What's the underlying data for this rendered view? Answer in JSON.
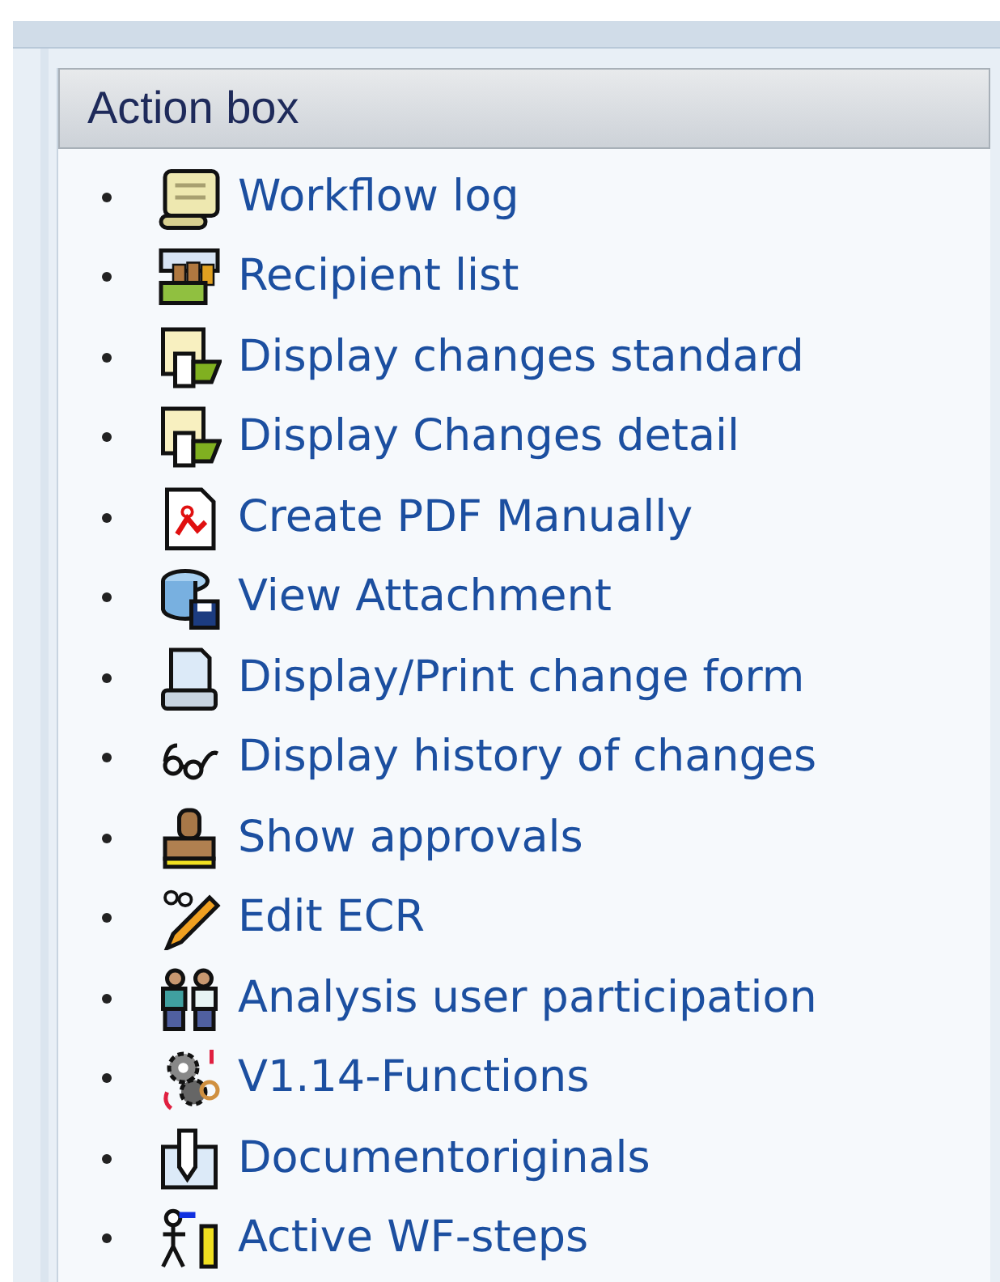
{
  "panel": {
    "title": "Action box",
    "items": [
      {
        "label": "Workflow log"
      },
      {
        "label": "Recipient list"
      },
      {
        "label": "Display changes standard"
      },
      {
        "label": "Display Changes detail"
      },
      {
        "label": "Create PDF Manually"
      },
      {
        "label": "View Attachment"
      },
      {
        "label": "Display/Print change form"
      },
      {
        "label": "Display history of changes"
      },
      {
        "label": "Show approvals"
      },
      {
        "label": "Edit ECR"
      },
      {
        "label": "Analysis user participation"
      },
      {
        "label": "V1.14-Functions"
      },
      {
        "label": "Documentoriginals"
      },
      {
        "label": "Active WF-steps"
      }
    ]
  }
}
